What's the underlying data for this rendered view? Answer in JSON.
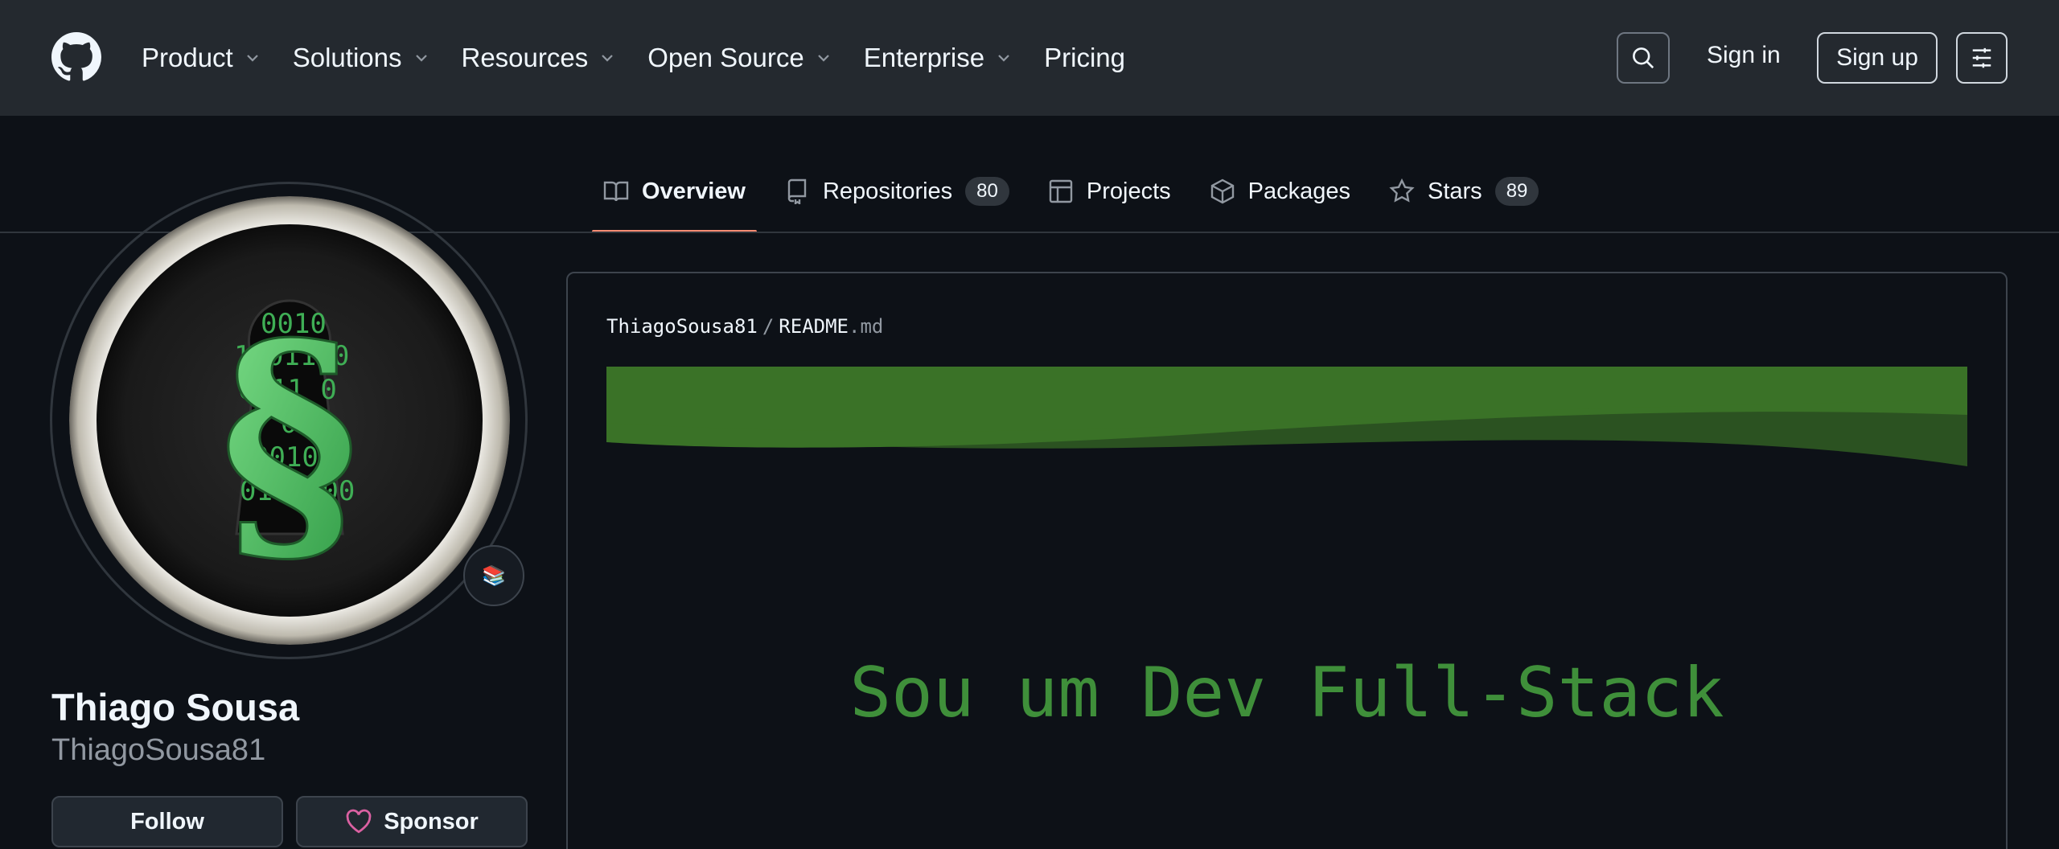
{
  "header": {
    "nav": [
      {
        "label": "Product",
        "dropdown": true
      },
      {
        "label": "Solutions",
        "dropdown": true
      },
      {
        "label": "Resources",
        "dropdown": true
      },
      {
        "label": "Open Source",
        "dropdown": true
      },
      {
        "label": "Enterprise",
        "dropdown": true
      },
      {
        "label": "Pricing",
        "dropdown": false
      }
    ],
    "sign_in": "Sign in",
    "sign_up": "Sign up"
  },
  "tabs": [
    {
      "label": "Overview",
      "icon": "book-icon",
      "active": true
    },
    {
      "label": "Repositories",
      "icon": "repo-icon",
      "count": "80"
    },
    {
      "label": "Projects",
      "icon": "table-icon"
    },
    {
      "label": "Packages",
      "icon": "package-icon"
    },
    {
      "label": "Stars",
      "icon": "star-icon",
      "count": "89"
    }
  ],
  "profile": {
    "name": "Thiago Sousa",
    "login": "ThiagoSousa81",
    "follow_label": "Follow",
    "sponsor_label": "Sponsor",
    "status_emoji": "📚"
  },
  "readme": {
    "owner": "ThiagoSousa81",
    "file": "README",
    "ext": ".md",
    "typing_text": "Sou um Dev Full-Stack"
  },
  "colors": {
    "header_bg": "#24292f",
    "page_bg": "#0d1117",
    "tab_underline": "#fd8c73",
    "banner_green": "#3a7227",
    "typing_green": "#3f8f3a"
  }
}
